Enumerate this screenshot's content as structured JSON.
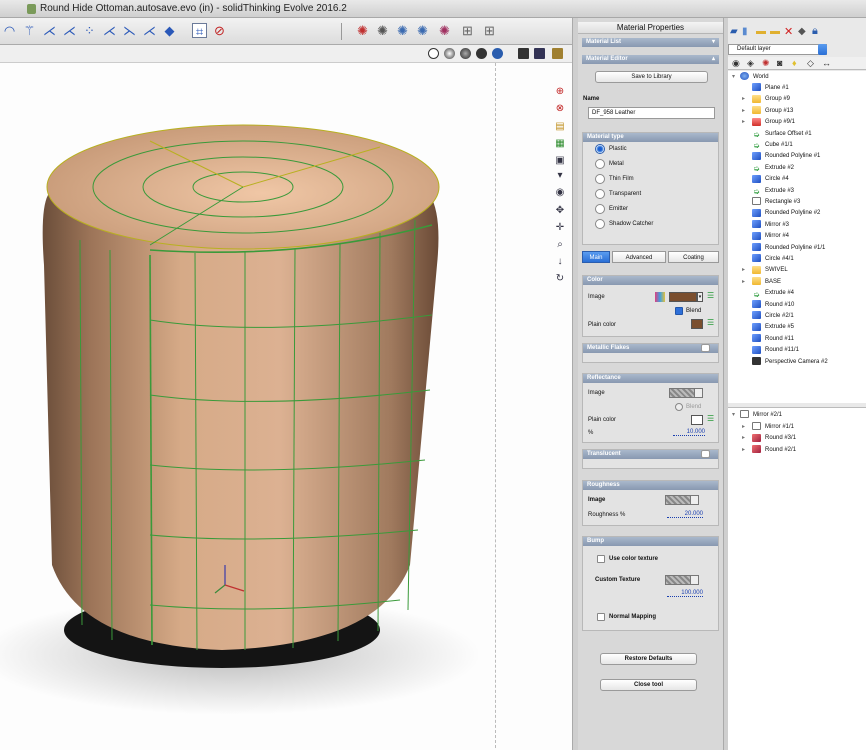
{
  "window": {
    "title": "Round Hide Ottoman.autosave.evo (in) - solidThinking Evolve 2016.2"
  },
  "colors": {
    "leather": "#c99b78",
    "wire": "#3a9a3a",
    "accent_blue": "#2a6fd6",
    "swatch_brown": "#7a4e2e"
  },
  "toolbar": {
    "icons": [
      "curve-icon",
      "sketch-icon",
      "polyline-icon",
      "polyline2-icon",
      "points-icon",
      "trim-icon",
      "trim2-icon",
      "extrude-icon",
      "cube-icon",
      "selection-icon",
      "cancel-icon"
    ],
    "right_icons": [
      "render-icon",
      "material-icon",
      "environment-icon",
      "light-icon",
      "camera-icon",
      "grid-icon",
      "snap-icon"
    ]
  },
  "material": {
    "panel_title": "Material Properties",
    "list_label": "Material List",
    "editor_label": "Material Editor",
    "save_button": "Save to Library",
    "name_label": "Name",
    "name_value": "DF_958 Leather",
    "type_label": "Material type",
    "types": [
      "Plastic",
      "Metal",
      "Thin Film",
      "Transparent",
      "Emitter",
      "Shadow Catcher"
    ],
    "selected_type": "Plastic",
    "tabs": [
      "Main",
      "Advanced",
      "Coating"
    ],
    "active_tab": "Main",
    "color": {
      "label": "Color",
      "image_label": "Image",
      "blend_label": "Blend",
      "blend_checked": true,
      "plain_color_label": "Plain color"
    },
    "metallic": {
      "label": "Metallic Flakes"
    },
    "reflectance": {
      "label": "Reflectance",
      "image_label": "Image",
      "blend_label": "Blend",
      "plain_color_label": "Plain color",
      "percent_label": "%",
      "percent_value": "10.000"
    },
    "translucent": {
      "label": "Translucent"
    },
    "roughness": {
      "label": "Roughness",
      "image_label": "Image",
      "percent_label": "Roughness %",
      "percent_value": "20.000"
    },
    "bump": {
      "label": "Bump",
      "use_color_label": "Use color texture",
      "custom_label": "Custom Texture",
      "custom_value": "100.000",
      "normal_label": "Normal Mapping"
    },
    "restore_button": "Restore Defaults",
    "close_button": "Close tool"
  },
  "tree": {
    "layer": "Default layer",
    "root": "World",
    "items": [
      {
        "label": "Plane #1",
        "icon": "box3d",
        "expandable": false
      },
      {
        "label": "Group #9",
        "icon": "folder",
        "expandable": true
      },
      {
        "label": "Group #13",
        "icon": "folder",
        "expandable": true
      },
      {
        "label": "Group #9/1",
        "icon": "folder-red",
        "expandable": true
      },
      {
        "label": "Surface Offset #1",
        "icon": "arrow",
        "expandable": false
      },
      {
        "label": "Cube #1/1",
        "icon": "arrow",
        "expandable": false
      },
      {
        "label": "Rounded Polyline #1",
        "icon": "box3d",
        "expandable": false
      },
      {
        "label": "Extrude #2",
        "icon": "arrow",
        "expandable": false
      },
      {
        "label": "Circle #4",
        "icon": "box3d",
        "expandable": false
      },
      {
        "label": "Extrude #3",
        "icon": "arrow",
        "expandable": false
      },
      {
        "label": "Rectangle #3",
        "icon": "rect",
        "expandable": false
      },
      {
        "label": "Rounded Polyline #2",
        "icon": "box3d",
        "expandable": false
      },
      {
        "label": "Mirror #3",
        "icon": "box3d",
        "expandable": false
      },
      {
        "label": "Mirror #4",
        "icon": "box3d",
        "expandable": false
      },
      {
        "label": "Rounded Polyline #1/1",
        "icon": "box3d",
        "expandable": false
      },
      {
        "label": "Circle #4/1",
        "icon": "box3d",
        "expandable": false
      },
      {
        "label": "SWIVEL",
        "icon": "folder",
        "expandable": true
      },
      {
        "label": "BASE",
        "icon": "folder",
        "expandable": true
      },
      {
        "label": "Extrude #4",
        "icon": "arrow",
        "expandable": false
      },
      {
        "label": "Round #10",
        "icon": "box3d",
        "expandable": false
      },
      {
        "label": "Circle #2/1",
        "icon": "box3d",
        "expandable": false
      },
      {
        "label": "Extrude #5",
        "icon": "box3d",
        "expandable": false
      },
      {
        "label": "Round #11",
        "icon": "box3d",
        "expandable": false
      },
      {
        "label": "Round #11/1",
        "icon": "box3d",
        "expandable": false
      },
      {
        "label": "Perspective Camera #2",
        "icon": "cam",
        "expandable": false
      }
    ],
    "history_root": "Mirror #2/1",
    "history": [
      {
        "label": "Mirror #1/1",
        "icon": "rect"
      },
      {
        "label": "Round #3/1",
        "icon": "pink"
      },
      {
        "label": "Round #2/1",
        "icon": "pink"
      }
    ]
  }
}
